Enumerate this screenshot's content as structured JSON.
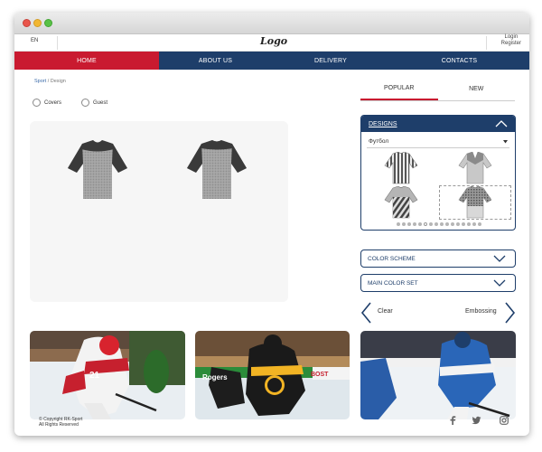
{
  "topbar": {
    "lang": "EN",
    "logo": "Logo",
    "login": "Login",
    "register": "Register"
  },
  "nav": [
    {
      "label": "HOME",
      "active": true
    },
    {
      "label": "ABOUT US",
      "active": false
    },
    {
      "label": "DELIVERY",
      "active": false
    },
    {
      "label": "CONTACTS",
      "active": false
    }
  ],
  "breadcrumb": {
    "link": "Sport",
    "separator": "/",
    "current": "Design"
  },
  "options": [
    {
      "label": "Covers"
    },
    {
      "label": "Guest"
    }
  ],
  "tabs": [
    {
      "label": "POPULAR",
      "active": true
    },
    {
      "label": "NEW",
      "active": false
    }
  ],
  "designs": {
    "title": "DESIGNS",
    "select_value": "Футбол"
  },
  "accordions": [
    {
      "label": "COLOR SCHEME"
    },
    {
      "label": "MAIN COLOR SET"
    }
  ],
  "actions": {
    "clear": "Clear",
    "embossing": "Embossing"
  },
  "footer": {
    "copyright": "© Copyright RK-Sport",
    "rights": "All Rights Reserved"
  },
  "colors": {
    "navy": "#1e3e6a",
    "accent": "#c91a30"
  },
  "icons": [
    "chevron-up-icon",
    "chevron-down-icon",
    "caret-down-icon",
    "arrow-left-icon",
    "arrow-right-icon",
    "facebook-icon",
    "twitter-icon",
    "instagram-icon"
  ]
}
